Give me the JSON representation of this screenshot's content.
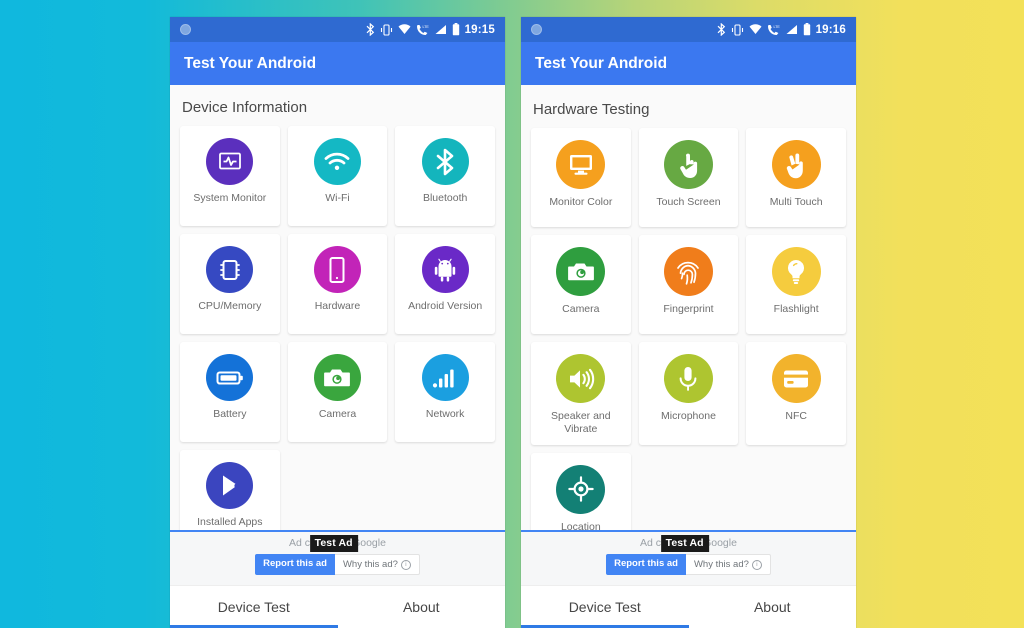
{
  "background": {
    "gradient_from": "#10b8de",
    "gradient_mid": "#7ecb92",
    "gradient_to": "#f3e158"
  },
  "phones": [
    {
      "id": "phone-left",
      "status_bar": {
        "time": "19:15",
        "icons": [
          "bluetooth-icon",
          "vibrate-icon",
          "wifi-icon",
          "lte-call-icon",
          "cellular-signal-icon",
          "battery-icon"
        ]
      },
      "app_bar": {
        "title": "Test Your Android"
      },
      "section_title": "Device Information",
      "tiles": [
        {
          "label": "System Monitor",
          "icon": "system-monitor-icon",
          "color": "#5b2fbd"
        },
        {
          "label": "Wi-Fi",
          "icon": "wifi-icon",
          "color": "#14b8c4"
        },
        {
          "label": "Bluetooth",
          "icon": "bluetooth-icon",
          "color": "#14b5bd"
        },
        {
          "label": "CPU/Memory",
          "icon": "cpu-chip-icon",
          "color": "#3649c2"
        },
        {
          "label": "Hardware",
          "icon": "phone-hardware-icon",
          "color": "#c224b8"
        },
        {
          "label": "Android Version",
          "icon": "android-robot-icon",
          "color": "#6a29c7"
        },
        {
          "label": "Battery",
          "icon": "battery-icon",
          "color": "#1472d8"
        },
        {
          "label": "Camera",
          "icon": "camera-icon",
          "color": "#3aa63e"
        },
        {
          "label": "Network",
          "icon": "network-bars-icon",
          "color": "#1b9fe0"
        },
        {
          "label": "Installed Apps",
          "icon": "play-store-icon",
          "color": "#3b45bf"
        }
      ],
      "ad": {
        "closed_text": "Ad closed by Google",
        "badge": "Test Ad",
        "report_label": "Report this ad",
        "why_label": "Why this ad?"
      },
      "tabs": [
        {
          "label": "Device Test",
          "active": true
        },
        {
          "label": "About",
          "active": false
        }
      ]
    },
    {
      "id": "phone-right",
      "status_bar": {
        "time": "19:16",
        "icons": [
          "bluetooth-icon",
          "vibrate-icon",
          "wifi-icon",
          "lte-call-icon",
          "cellular-signal-icon",
          "battery-icon"
        ]
      },
      "app_bar": {
        "title": "Test Your Android"
      },
      "section_title": "Hardware Testing",
      "tiles": [
        {
          "label": "Monitor Color",
          "icon": "monitor-icon",
          "color": "#f5a01e"
        },
        {
          "label": "Touch Screen",
          "icon": "touch-hand-icon",
          "color": "#67a943"
        },
        {
          "label": "Multi Touch",
          "icon": "two-finger-icon",
          "color": "#f5a01e"
        },
        {
          "label": "Camera",
          "icon": "camera-icon",
          "color": "#2f9e3f"
        },
        {
          "label": "Fingerprint",
          "icon": "fingerprint-icon",
          "color": "#f07d1b"
        },
        {
          "label": "Flashlight",
          "icon": "lightbulb-icon",
          "color": "#f5cc3e"
        },
        {
          "label": "Speaker and Vibrate",
          "icon": "speaker-icon",
          "color": "#aec530"
        },
        {
          "label": "Microphone",
          "icon": "microphone-icon",
          "color": "#aec530"
        },
        {
          "label": "NFC",
          "icon": "nfc-card-icon",
          "color": "#f2b32c"
        },
        {
          "label": "Location",
          "icon": "location-crosshair-icon",
          "color": "#138075"
        }
      ],
      "ad": {
        "closed_text": "Ad closed by Google",
        "badge": "Test Ad",
        "report_label": "Report this ad",
        "why_label": "Why this ad?"
      },
      "tabs": [
        {
          "label": "Device Test",
          "active": true
        },
        {
          "label": "About",
          "active": false
        }
      ]
    }
  ]
}
